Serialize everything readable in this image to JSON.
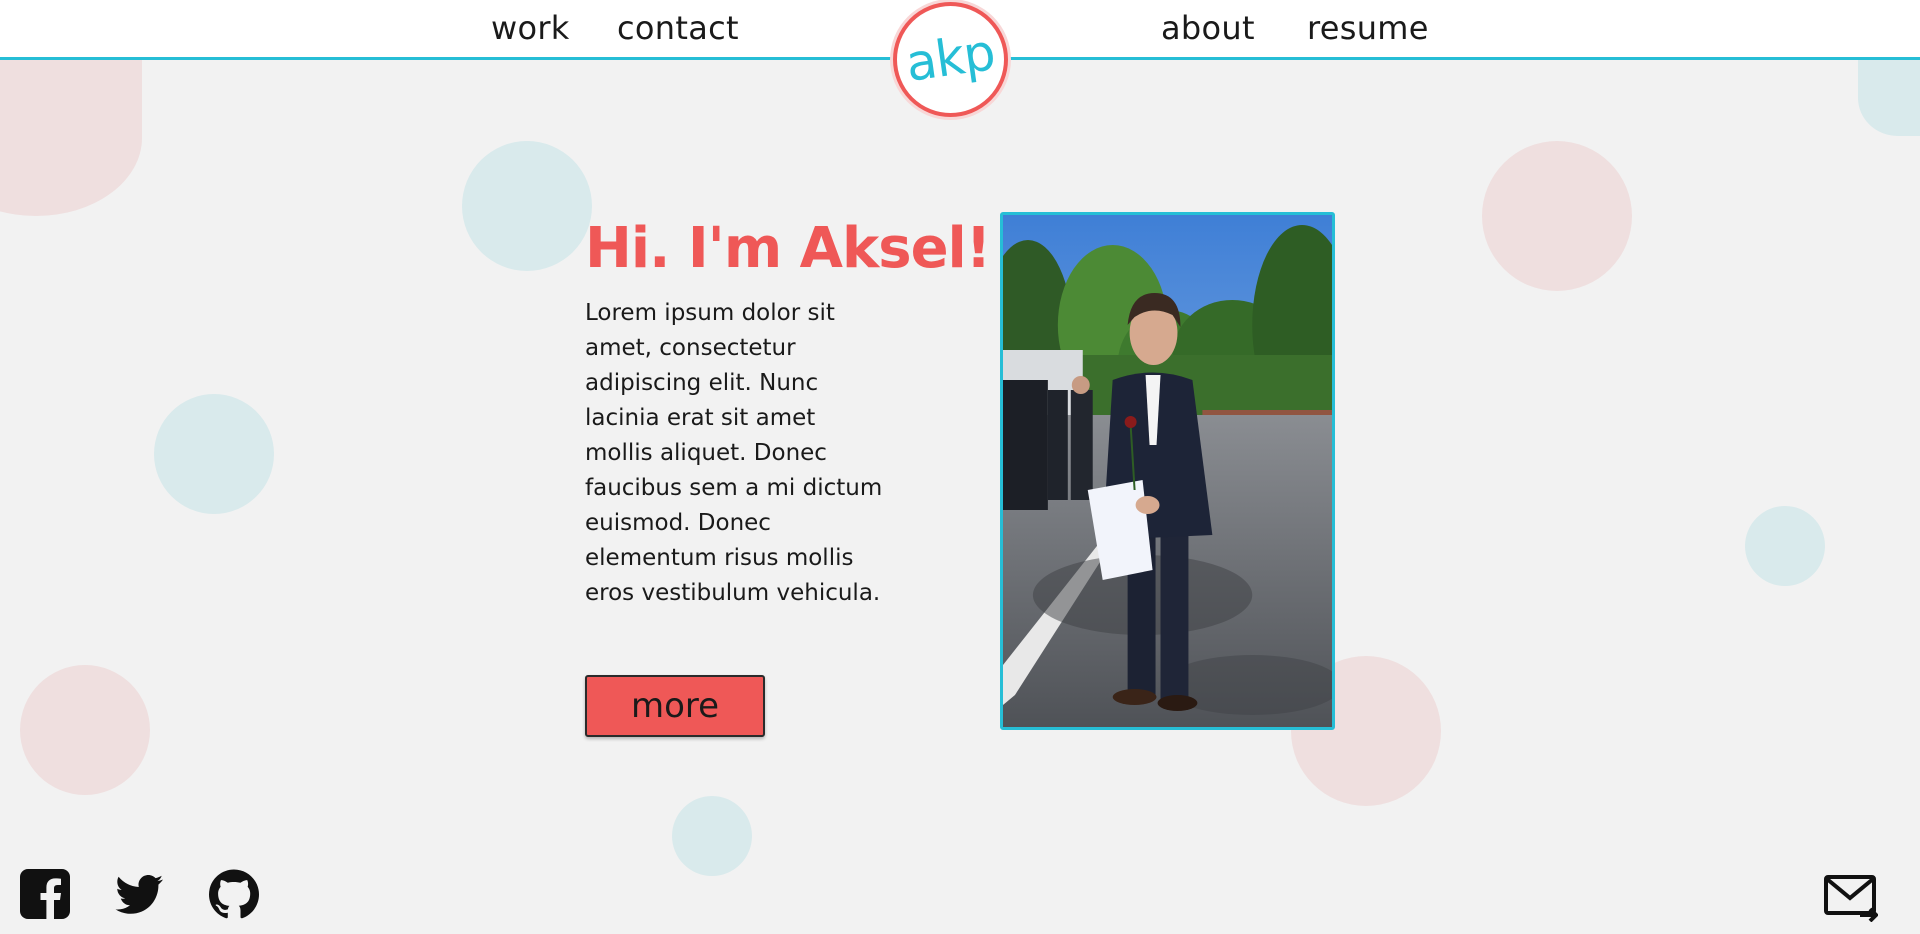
{
  "nav": {
    "work_label": "work",
    "contact_label": "contact",
    "about_label": "about",
    "resume_label": "resume"
  },
  "logo": {
    "text": "akp"
  },
  "hero": {
    "title": "Hi. I'm Aksel!",
    "body": "Lorem ipsum dolor sit amet, consectetur adipiscing elit. Nunc lacinia erat sit amet mollis aliquet. Donec faucibus sem a mi dictum euismod. Donec elementum risus mollis eros vestibulum vehicula.",
    "more_label": "more"
  },
  "footer": {
    "icons": [
      "facebook-icon",
      "twitter-icon",
      "github-icon",
      "mail-icon"
    ]
  },
  "colors": {
    "accent_red": "#ef5857",
    "accent_blue": "#26bed6",
    "background": "#f2f2f2",
    "bubble_pink": "#efdfdf",
    "bubble_blue": "#d9eaec"
  }
}
